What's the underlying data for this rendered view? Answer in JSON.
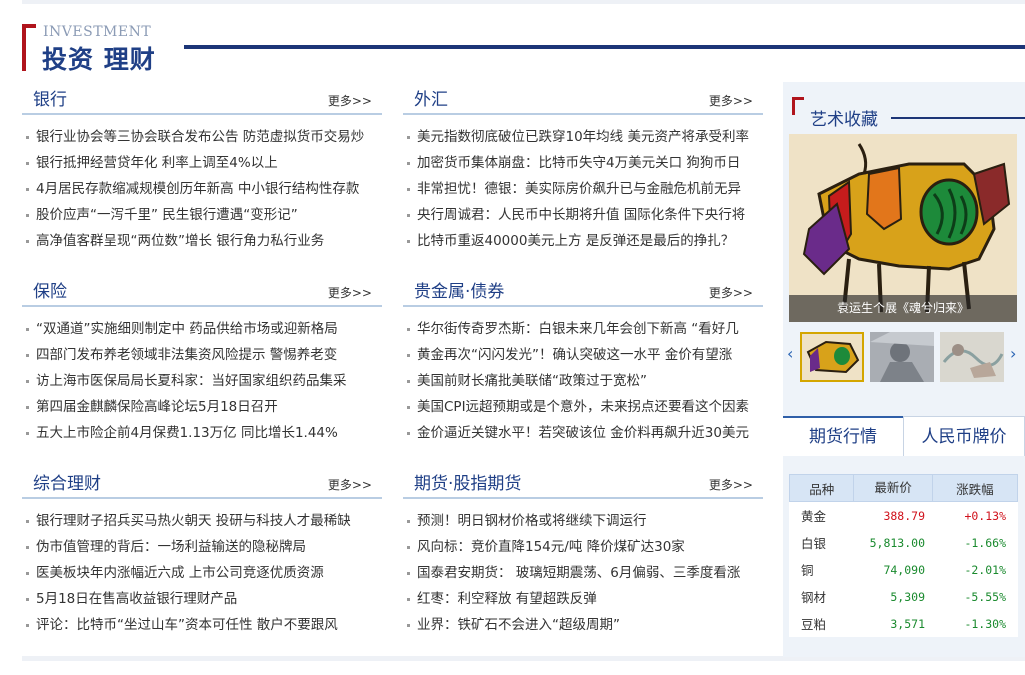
{
  "header": {
    "en_title": "INVESTMENT",
    "cn_title": "投资 理财"
  },
  "sections": {
    "bank": {
      "title": "银行",
      "more": "更多>>",
      "items": [
        "银行业协会等三协会联合发布公告 防范虚拟货币交易炒",
        "银行抵押经营贷年化 利率上调至4%以上",
        "4月居民存款缩减规模创历年新高 中小银行结构性存款",
        "股价应声“一泻千里” 民生银行遭遇“变形记”",
        "高净值客群呈现“两位数”增长 银行角力私行业务"
      ]
    },
    "fx": {
      "title": "外汇",
      "more": "更多>>",
      "items": [
        "美元指数彻底破位已跌穿10年均线 美元资产将承受利率",
        "加密货币集体崩盘：比特币失守4万美元关口 狗狗币日",
        "非常担忧！德银：美实际房价飙升已与金融危机前无异",
        "央行周诚君：人民币中长期将升值 国际化条件下央行将",
        "比特币重返40000美元上方 是反弹还是最后的挣扎？"
      ]
    },
    "insurance": {
      "title": "保险",
      "more": "更多>>",
      "items": [
        "“双通道”实施细则制定中 药品供给市场或迎新格局",
        "四部门发布养老领域非法集资风险提示 警惕养老变",
        "访上海市医保局局长夏科家：当好国家组织药品集采",
        "第四届金麒麟保险高峰论坛5月18日召开",
        "五大上市险企前4月保费1.13万亿 同比增长1.44%"
      ]
    },
    "metals": {
      "title": "贵金属·债券",
      "more": "更多>>",
      "items": [
        "华尔街传奇罗杰斯：白银未来几年会创下新高 “看好几",
        "黄金再次“闪闪发光”！确认突破这一水平 金价有望涨",
        "美国前财长痛批美联储“政策过于宽松”",
        "美国CPI远超预期或是个意外，未来拐点还要看这个因素",
        "金价逼近关键水平！若突破该位 金价料再飙升近30美元"
      ]
    },
    "wealth": {
      "title": "综合理财",
      "more": "更多>>",
      "items": [
        "银行理财子招兵买马热火朝天 投研与科技人才最稀缺",
        "伪市值管理的背后：一场利益输送的隐秘牌局",
        "医美板块年内涨幅近六成 上市公司竞逐优质资源",
        "5月18日在售高收益银行理财产品",
        "评论：比特币“坐过山车”资本可任性 散户不要跟风"
      ]
    },
    "futures": {
      "title": "期货·股指期货",
      "more": "更多>>",
      "items": [
        "预测！明日钢材价格或将继续下调运行",
        "风向标：竞价直降154元/吨 降价煤矿达30家",
        "国泰君安期货： 玻璃短期震荡、6月偏弱、三季度看涨",
        "红枣：利空释放 有望超跌反弹",
        "业界：铁矿石不会进入“超级周期”"
      ]
    }
  },
  "art": {
    "title": "艺术收藏",
    "caption": "袁运生个展《魂兮归来》",
    "prev_icon": "chevron-left-icon",
    "next_icon": "chevron-right-icon"
  },
  "quotes": {
    "tab_futures": "期货行情",
    "tab_rmb": "人民币牌价",
    "headers": [
      "品种",
      "最新价",
      "涨跌幅"
    ],
    "rows": [
      {
        "name": "黄金",
        "price": "388.79",
        "change": "+0.13%",
        "dir": "up"
      },
      {
        "name": "白银",
        "price": "5,813.00",
        "change": "-1.66%",
        "dir": "down"
      },
      {
        "name": "铜",
        "price": "74,090",
        "change": "-2.01%",
        "dir": "down"
      },
      {
        "name": "钢材",
        "price": "5,309",
        "change": "-5.55%",
        "dir": "down"
      },
      {
        "name": "豆粕",
        "price": "3,571",
        "change": "-1.30%",
        "dir": "down"
      }
    ],
    "colors": {
      "up": "#d0121c",
      "down": "#1a8a2e"
    }
  }
}
